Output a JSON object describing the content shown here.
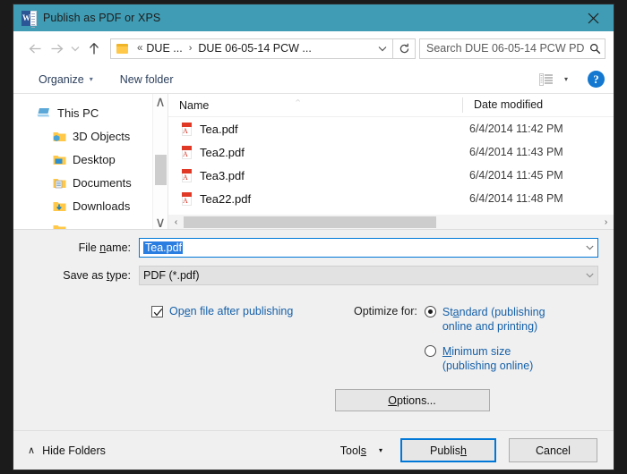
{
  "window": {
    "title": "Publish as PDF or XPS",
    "app_icon": "word-icon",
    "close_label": "✕",
    "titlebar_color": "#3f9cb4"
  },
  "nav": {
    "back_icon": "back-arrow-icon",
    "forward_icon": "forward-arrow-icon",
    "recent_icon": "chevron-down-icon",
    "up_icon": "up-arrow-icon",
    "breadcrumb": {
      "folder_icon": "folder-icon",
      "overflow": "«",
      "segments": [
        "DUE ...",
        "DUE 06-05-14 PCW ..."
      ],
      "separator": "›",
      "dropdown_icon": "chevron-down-icon"
    },
    "refresh_icon": "refresh-icon",
    "search": {
      "placeholder": "Search DUE 06-05-14 PCW PD...",
      "value": "",
      "icon": "search-icon"
    }
  },
  "toolbar": {
    "organize_label": "Organize",
    "organize_caret": "▾",
    "new_folder_label": "New folder",
    "view_icon": "view-layout-icon",
    "view_caret": "▾",
    "help_label": "?"
  },
  "sidebar": {
    "items": [
      {
        "label": "This PC",
        "icon": "this-pc-icon",
        "indent": false
      },
      {
        "label": "3D Objects",
        "icon": "folder-3d-objects-icon",
        "indent": true
      },
      {
        "label": "Desktop",
        "icon": "folder-desktop-icon",
        "indent": true
      },
      {
        "label": "Documents",
        "icon": "folder-documents-icon",
        "indent": true
      },
      {
        "label": "Downloads",
        "icon": "folder-downloads-icon",
        "indent": true
      }
    ],
    "scroll_up_icon": "∧",
    "scroll_down_icon": "∨"
  },
  "filelist": {
    "columns": [
      "Name",
      "Date modified"
    ],
    "sort_indicator": "⌃",
    "rows": [
      {
        "name": "Tea.pdf",
        "date": "6/4/2014 11:42 PM",
        "icon": "pdf-file-icon"
      },
      {
        "name": "Tea2.pdf",
        "date": "6/4/2014 11:43 PM",
        "icon": "pdf-file-icon"
      },
      {
        "name": "Tea3.pdf",
        "date": "6/4/2014 11:45 PM",
        "icon": "pdf-file-icon"
      },
      {
        "name": "Tea22.pdf",
        "date": "6/4/2014 11:48 PM",
        "icon": "pdf-file-icon"
      }
    ],
    "hscroll_left_icon": "‹",
    "hscroll_right_icon": "›"
  },
  "form": {
    "filename_label_pre": "File ",
    "filename_label_accel": "n",
    "filename_label_post": "ame:",
    "filename_value": "Tea.pdf",
    "savetype_label_pre": "Save as ",
    "savetype_label_accel": "t",
    "savetype_label_post": "ype:",
    "savetype_value": "PDF (*.pdf)",
    "dropdown_icon": "chevron-down-icon",
    "open_after_pre": "Op",
    "open_after_accel": "e",
    "open_after_post": "n file after publishing",
    "open_after_checked": true,
    "check_icon": "checkmark-icon",
    "optimize_label": "Optimize for:",
    "radios": [
      {
        "pre": "St",
        "accel": "a",
        "post": "ndard (publishing",
        "line2": "online and printing)",
        "selected": true
      },
      {
        "pre": "",
        "accel": "M",
        "post": "inimum size",
        "line2": "(publishing online)",
        "selected": false
      }
    ],
    "options_pre": "",
    "options_accel": "O",
    "options_post": "ptions..."
  },
  "footer": {
    "hide_folders_caret": "∧",
    "hide_folders_label": "Hide Folders",
    "tools_pre": "Tool",
    "tools_accel": "s",
    "tools_post": "",
    "tools_caret": "▾",
    "publish_pre": "Publis",
    "publish_accel": "h",
    "publish_post": "",
    "cancel_label": "Cancel"
  },
  "colors": {
    "titlebar": "#3f9cb4",
    "accent_blue": "#0078d7",
    "link_blue": "#1560a8",
    "selection_blue": "#2a7de1",
    "pdf_red": "#e03a27",
    "help_blue": "#1478d0"
  }
}
